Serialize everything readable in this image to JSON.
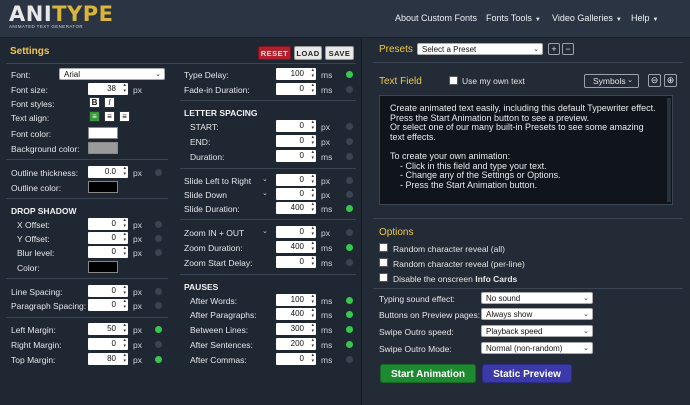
{
  "logo": {
    "main_a": "ANI",
    "main_b": "TYPE",
    "subtitle": "ANIMATED TEXT GENERATOR"
  },
  "nav": {
    "items": [
      {
        "label": "About Custom Fonts"
      },
      {
        "label": "Fonts Tools"
      },
      {
        "label": "Video Galleries"
      },
      {
        "label": "Help"
      }
    ]
  },
  "settings": {
    "title": "Settings",
    "reset": "RESET",
    "load": "LOAD",
    "save": "SAVE",
    "font_label": "Font:",
    "font_value": "Arial",
    "font_size_label": "Font size:",
    "font_size": "38",
    "font_styles_label": "Font styles:",
    "bold": "B",
    "italic": "I",
    "text_align_label": "Text align:",
    "font_color_label": "Font color:",
    "font_color": "#ffffff",
    "bg_color_label": "Background color:",
    "bg_color": "#9a9a9a",
    "outline_thickness_label": "Outline thickness:",
    "outline_thickness": "0.0",
    "outline_color_label": "Outline color:",
    "outline_color": "#000000",
    "drop_shadow": "DROP SHADOW",
    "x_offset_label": "X Offset:",
    "x_offset": "0",
    "y_offset_label": "Y Offset:",
    "y_offset": "0",
    "blur_label": "Blur level:",
    "blur": "0",
    "shadow_color_label": "Color:",
    "shadow_color": "#000000",
    "line_spacing_label": "Line Spacing:",
    "line_spacing": "0",
    "para_spacing_label": "Paragraph Spacing:",
    "para_spacing": "0",
    "left_margin_label": "Left Margin:",
    "left_margin": "50",
    "right_margin_label": "Right Margin:",
    "right_margin": "0",
    "top_margin_label": "Top Margin:",
    "top_margin": "80",
    "px": "px",
    "ms": "ms",
    "type_delay_label": "Type Delay:",
    "type_delay": "100",
    "fade_in_label": "Fade-in Duration:",
    "fade_in": "0",
    "letter_spacing": "LETTER SPACING",
    "ls_start_label": "START:",
    "ls_start": "0",
    "ls_end_label": "END:",
    "ls_end": "0",
    "ls_duration_label": "Duration:",
    "ls_duration": "0",
    "slide_lr_label": "Slide Left to Right",
    "slide_lr": "0",
    "slide_down_label": "Slide Down",
    "slide_down": "0",
    "slide_duration_label": "Slide Duration:",
    "slide_duration": "400",
    "zoom_label": "Zoom IN + OUT",
    "zoom": "0",
    "zoom_duration_label": "Zoom Duration:",
    "zoom_duration": "400",
    "zoom_start_label": "Zoom Start Delay:",
    "zoom_start": "0",
    "pauses": "PAUSES",
    "after_words_label": "After Words:",
    "after_words": "100",
    "after_paragraphs_label": "After Paragraphs:",
    "after_paragraphs": "400",
    "between_lines_label": "Between Lines:",
    "between_lines": "300",
    "after_sentences_label": "After Sentences:",
    "after_sentences": "200",
    "after_commas_label": "After Commas:",
    "after_commas": "0"
  },
  "presets": {
    "title": "Presets",
    "select_value": "Select a Preset",
    "add": "+",
    "remove": "−"
  },
  "textfield": {
    "title": "Text Field",
    "own_text_label": "Use my own text",
    "symbols": "Symbols",
    "lines": [
      "Create animated text easily, including this default Typewriter effect.",
      "Press the Start Animation button to see a preview.",
      "Or select one of our many built-in Presets to see some amazing",
      "text effects.",
      "",
      "To create your own animation:",
      "    - Click in this field and type your text.",
      "    - Change any of the Settings or Options.",
      "    - Press the Start Animation button."
    ]
  },
  "options": {
    "title": "Options",
    "random_all": "Random character reveal (all)",
    "random_line": "Random character reveal (per-line)",
    "disable_prefix": "Disable the onscreen ",
    "disable_bold": "Info Cards",
    "typing_sound_label": "Typing sound effect:",
    "typing_sound": "No sound",
    "buttons_preview_label": "Buttons on Preview pages:",
    "buttons_preview": "Always show",
    "swipe_speed_label": "Swipe Outro speed:",
    "swipe_speed": "Playback speed",
    "swipe_mode_label": "Swipe Outro Mode:",
    "swipe_mode": "Normal (non-random)"
  },
  "actions": {
    "start": "Start Animation",
    "static": "Static Preview"
  },
  "colors": {
    "accent": "#f0c84b",
    "green": "#1e8a2f",
    "blue": "#3b3aa8",
    "reset": "#b21f2d"
  }
}
